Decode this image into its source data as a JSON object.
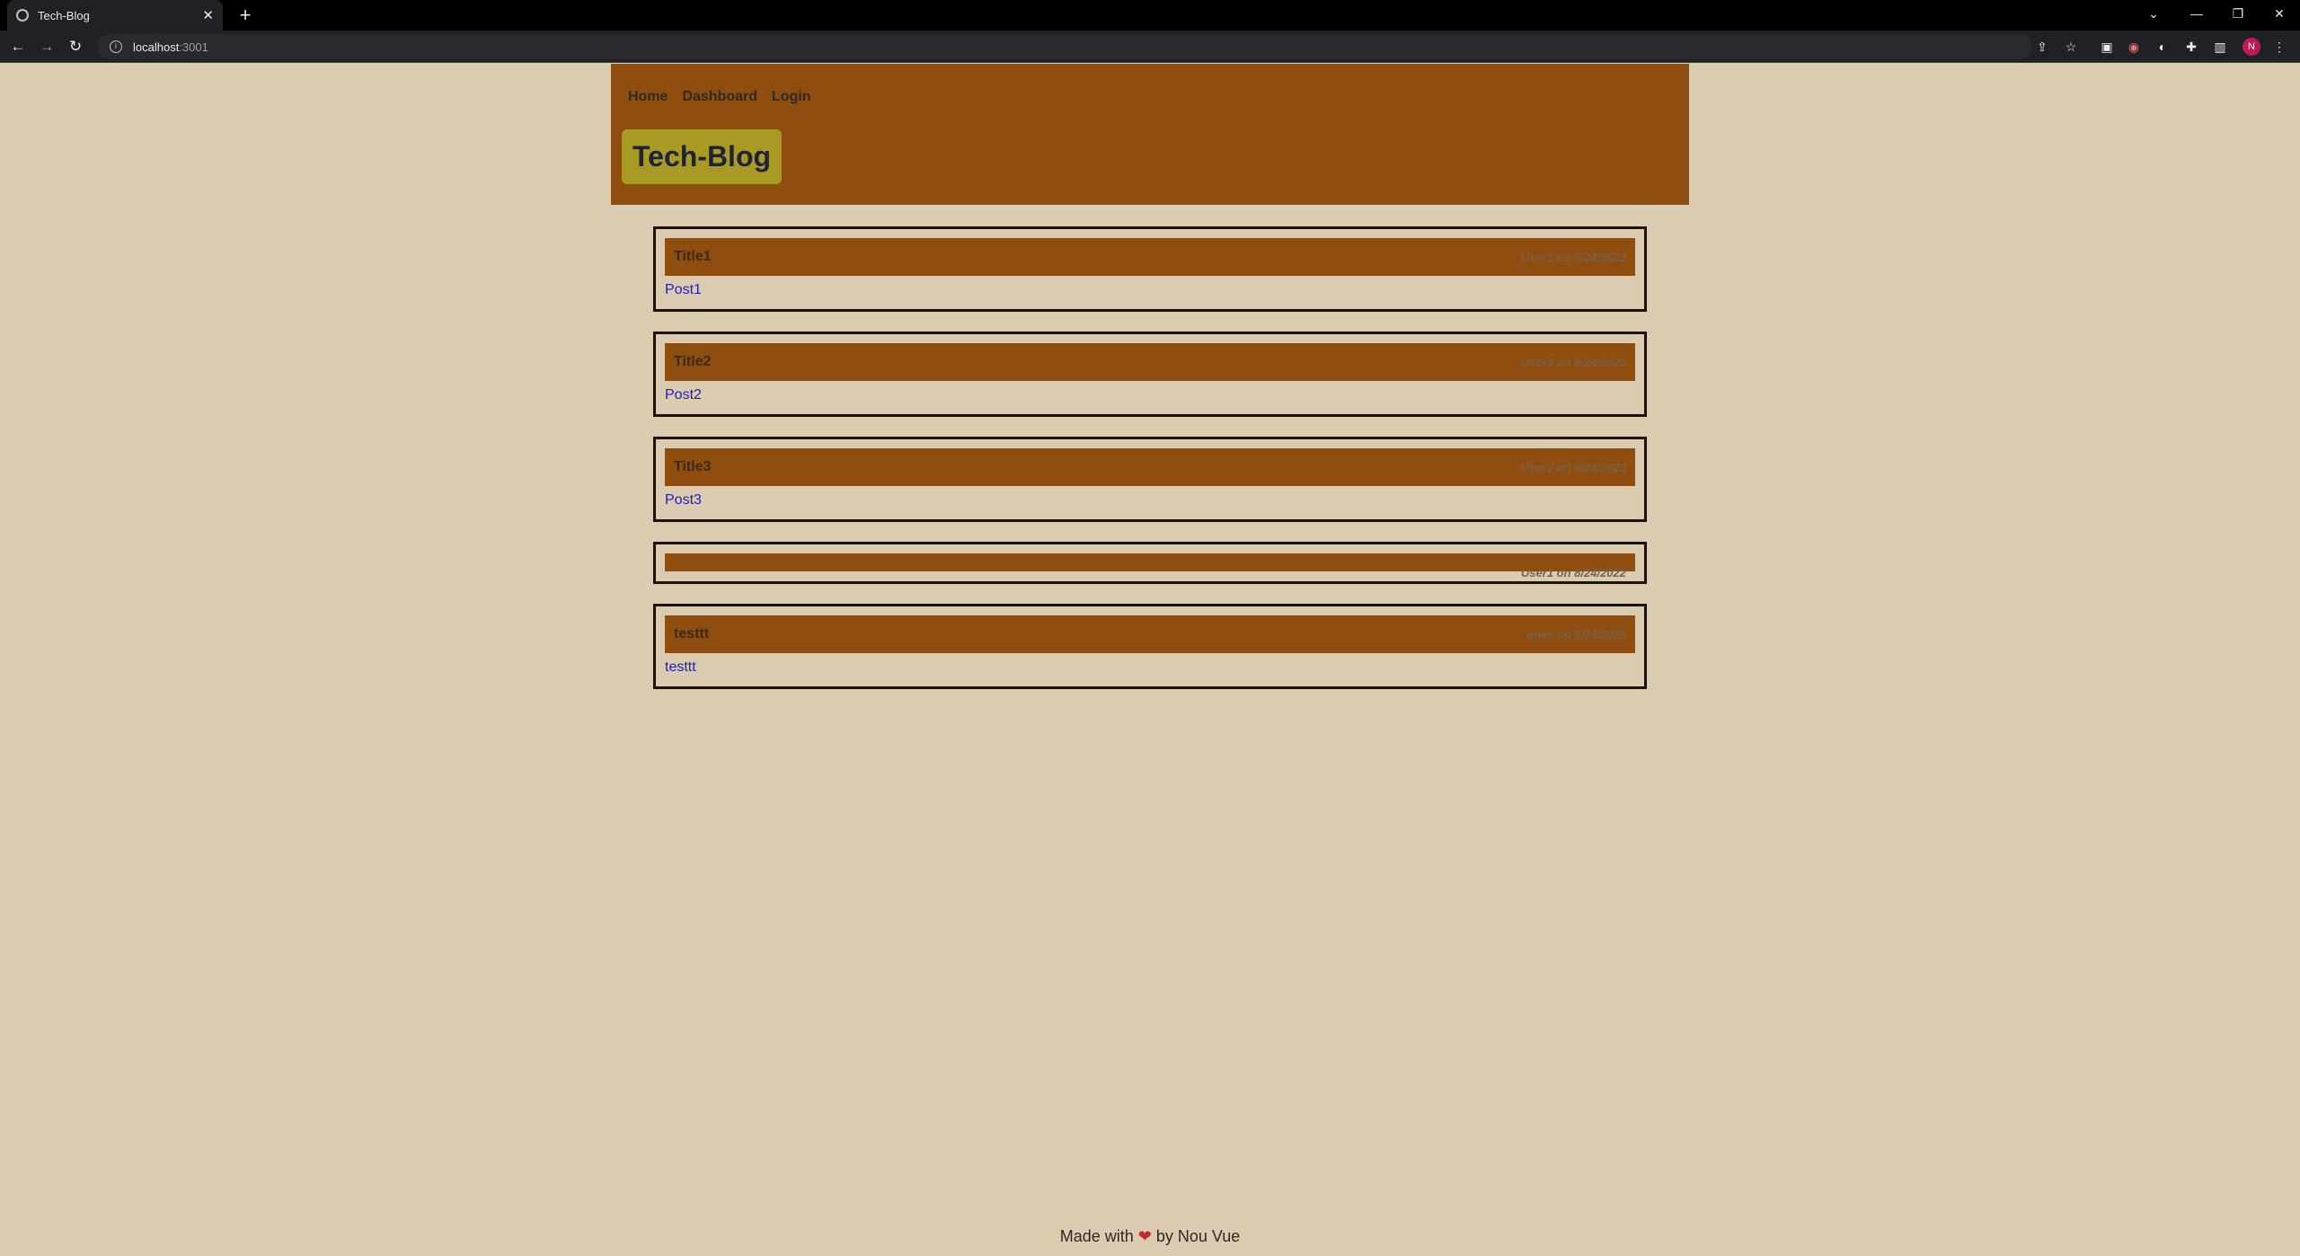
{
  "browser": {
    "tab_title": "Tech-Blog",
    "url_host": "localhost",
    "url_port": ":3001",
    "profile_initial": "N"
  },
  "nav": {
    "home": "Home",
    "dashboard": "Dashboard",
    "login": "Login"
  },
  "brand": "Tech-Blog",
  "posts": [
    {
      "title": "Title1",
      "meta": "User1 on 8/24/2022",
      "body": "Post1"
    },
    {
      "title": "Title2",
      "meta": "User3 on 8/24/2022",
      "body": "Post2"
    },
    {
      "title": "Title3",
      "meta": "User2 on 8/24/2022",
      "body": "Post3"
    },
    {
      "title": "",
      "meta": "User1 on 8/24/2022",
      "body": ""
    },
    {
      "title": "testtt",
      "meta": "qwer on 8/24/2022",
      "body": "testtt"
    }
  ],
  "footer": {
    "before": "Made with",
    "heart": "❤",
    "after": "by Nou Vue"
  },
  "colors": {
    "page_bg": "#dbcbb1",
    "header_bg": "#8f4d0f",
    "brand_bg": "#a89a24",
    "link": "#1f1fb8"
  }
}
